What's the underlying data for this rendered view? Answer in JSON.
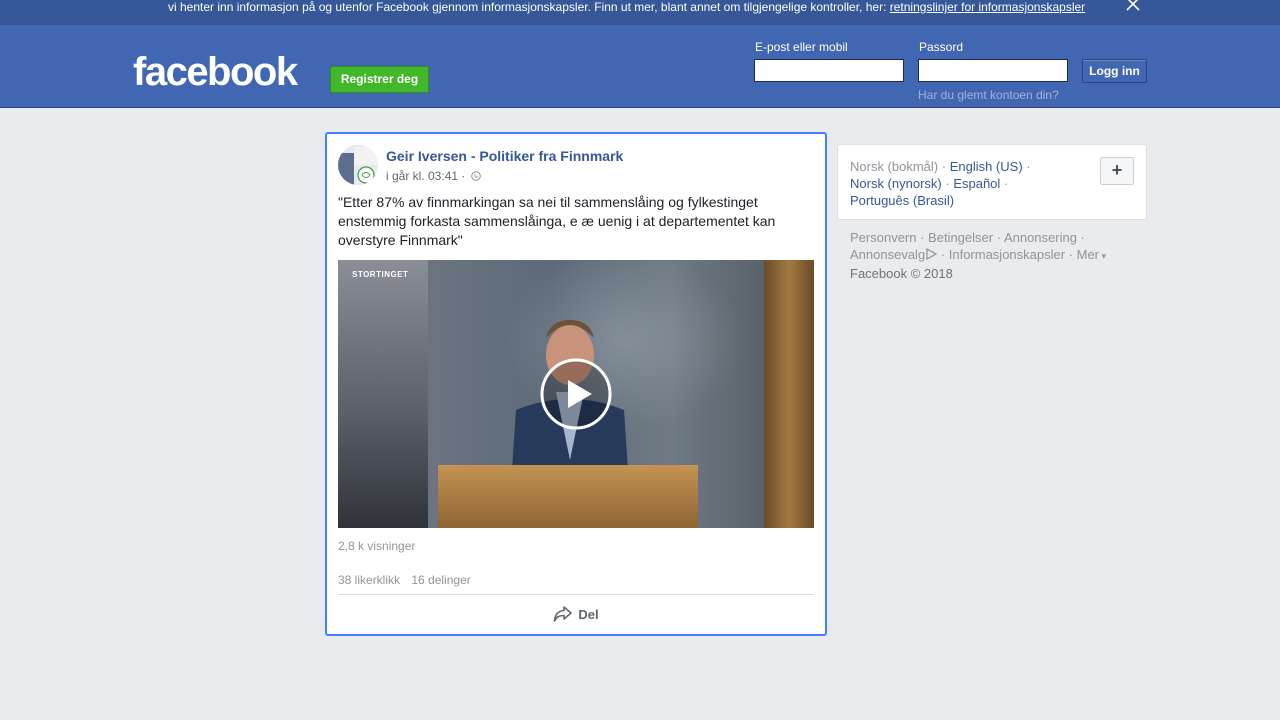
{
  "cookie_banner": {
    "text": "vi henter inn informasjon på og utenfor Facebook gjennom informasjonskapsler. Finn ut mer, blant annet om tilgjengelige kontroller, her:",
    "link": "retningslinjer for informasjonskapsler",
    "close_icon": "close-icon"
  },
  "header": {
    "logo": "facebook",
    "register_label": "Registrer deg",
    "email_label": "E-post eller mobil",
    "email_value": "",
    "password_label": "Passord",
    "password_value": "",
    "login_label": "Logg inn",
    "forgot_link": "Har du glemt kontoen din?"
  },
  "post": {
    "author": "Geir Iversen - Politiker fra Finnmark",
    "timestamp": "i går kl. 03:41",
    "separator": "·",
    "privacy_icon": "globe-icon",
    "text": "\"Etter 87% av finnmarkingan sa nei til sammenslåing og fylkestinget enstemmig forkasta sammenslåinga, e æ uenig i at departementet kan overstyre Finnmark\"",
    "video": {
      "logo_text": "STORTINGET",
      "play_icon": "play-icon"
    },
    "views": "2,8 k visninger",
    "likes": "38 likerklikk",
    "shares": "16 delinger",
    "share_label": "Del",
    "share_icon": "share-arrow-icon"
  },
  "sidebar": {
    "languages": {
      "current": "Norsk (bokmål)",
      "options": [
        "English (US)",
        "Norsk (nynorsk)",
        "Español",
        "Português (Brasil)"
      ],
      "add_label": "+"
    },
    "footer": {
      "links": [
        "Personvern",
        "Betingelser",
        "Annonsering",
        "Annonsevalg",
        "Informasjonskapsler",
        "Mer"
      ],
      "copyright": "Facebook © 2018"
    }
  },
  "colors": {
    "brand_blue": "#4267b2",
    "banner_blue": "#365899",
    "register_green": "#42b72a",
    "link_blue": "#365899",
    "background": "#e9ebee"
  }
}
